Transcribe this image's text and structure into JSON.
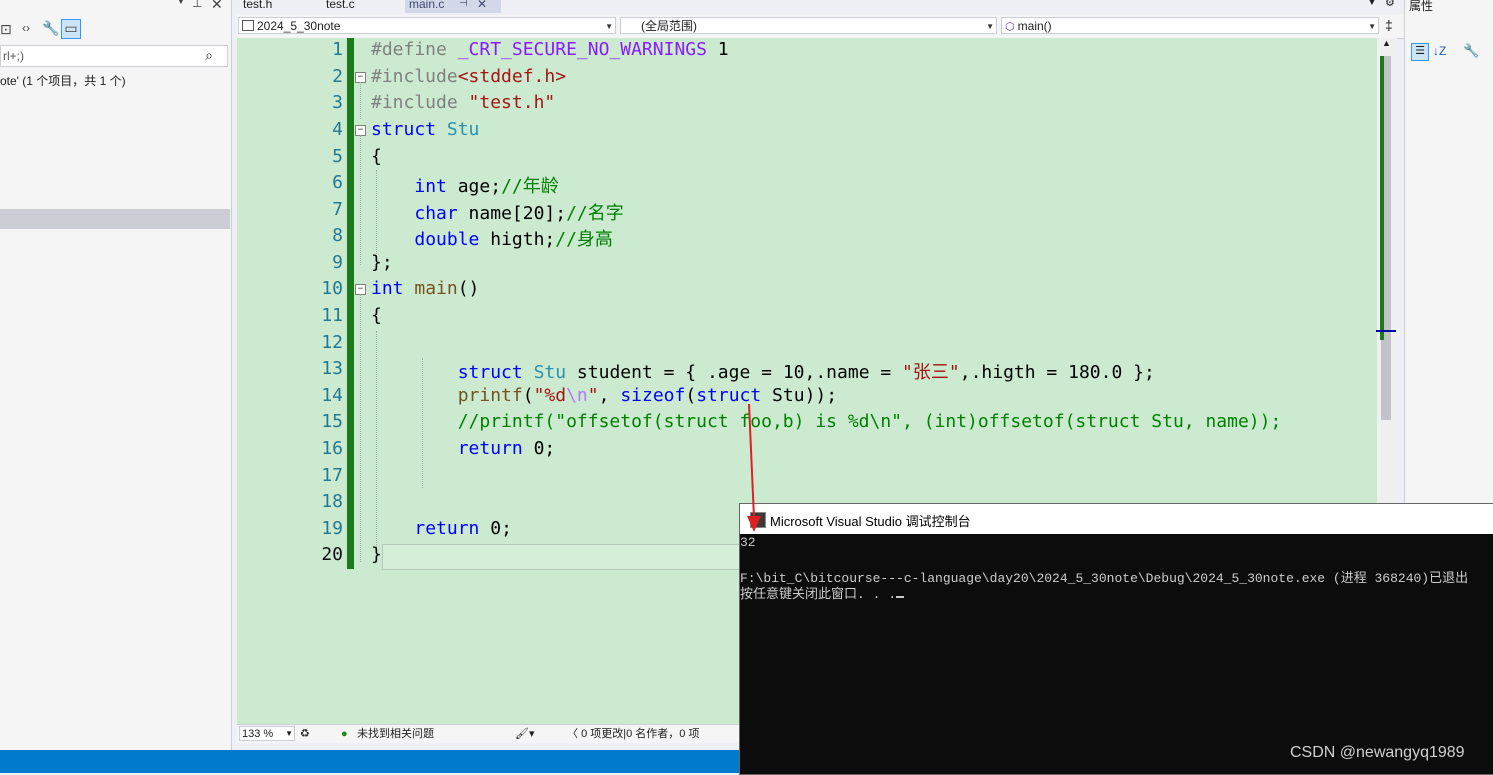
{
  "tabs": [
    {
      "label": "test.h",
      "active": false
    },
    {
      "label": "test.c",
      "active": false
    },
    {
      "label": "main.c",
      "active": true
    }
  ],
  "left_pane": {
    "search_placeholder": "rl+;)",
    "tree_text": "ote' (1 个项目，共 1 个)"
  },
  "navbar": {
    "project": "2024_5_30note",
    "scope": "(全局范围)",
    "function": "main()"
  },
  "right_pane": {
    "title": "属性"
  },
  "editor": {
    "lines": [
      {
        "n": "1"
      },
      {
        "n": "2"
      },
      {
        "n": "3"
      },
      {
        "n": "4"
      },
      {
        "n": "5"
      },
      {
        "n": "6"
      },
      {
        "n": "7"
      },
      {
        "n": "8"
      },
      {
        "n": "9"
      },
      {
        "n": "10"
      },
      {
        "n": "11"
      },
      {
        "n": "12"
      },
      {
        "n": "13"
      },
      {
        "n": "14"
      },
      {
        "n": "15"
      },
      {
        "n": "16"
      },
      {
        "n": "17"
      },
      {
        "n": "18"
      },
      {
        "n": "19"
      },
      {
        "n": "20"
      }
    ],
    "current_line": "20"
  },
  "status": {
    "zoom": "133 %",
    "issues": "未找到相关问题",
    "changes": "0 项更改|0 名作者，0 项"
  },
  "console": {
    "title": "Microsoft Visual Studio 调试控制台",
    "output_line1": "32",
    "output_line2": "F:\\bit_C\\bitcourse---c-language\\day20\\2024_5_30note\\Debug\\2024_5_30note.exe (进程 368240)已退出",
    "output_line3": "按任意键关闭此窗口. . ."
  },
  "watermark": "CSDN @newangyq1989",
  "colors": {
    "editor_bg": "#ccead0",
    "change_bar": "#1b7a1b",
    "console_bg": "#0c0c0c",
    "status_blue": "#007acc",
    "arrow": "#e02020"
  }
}
